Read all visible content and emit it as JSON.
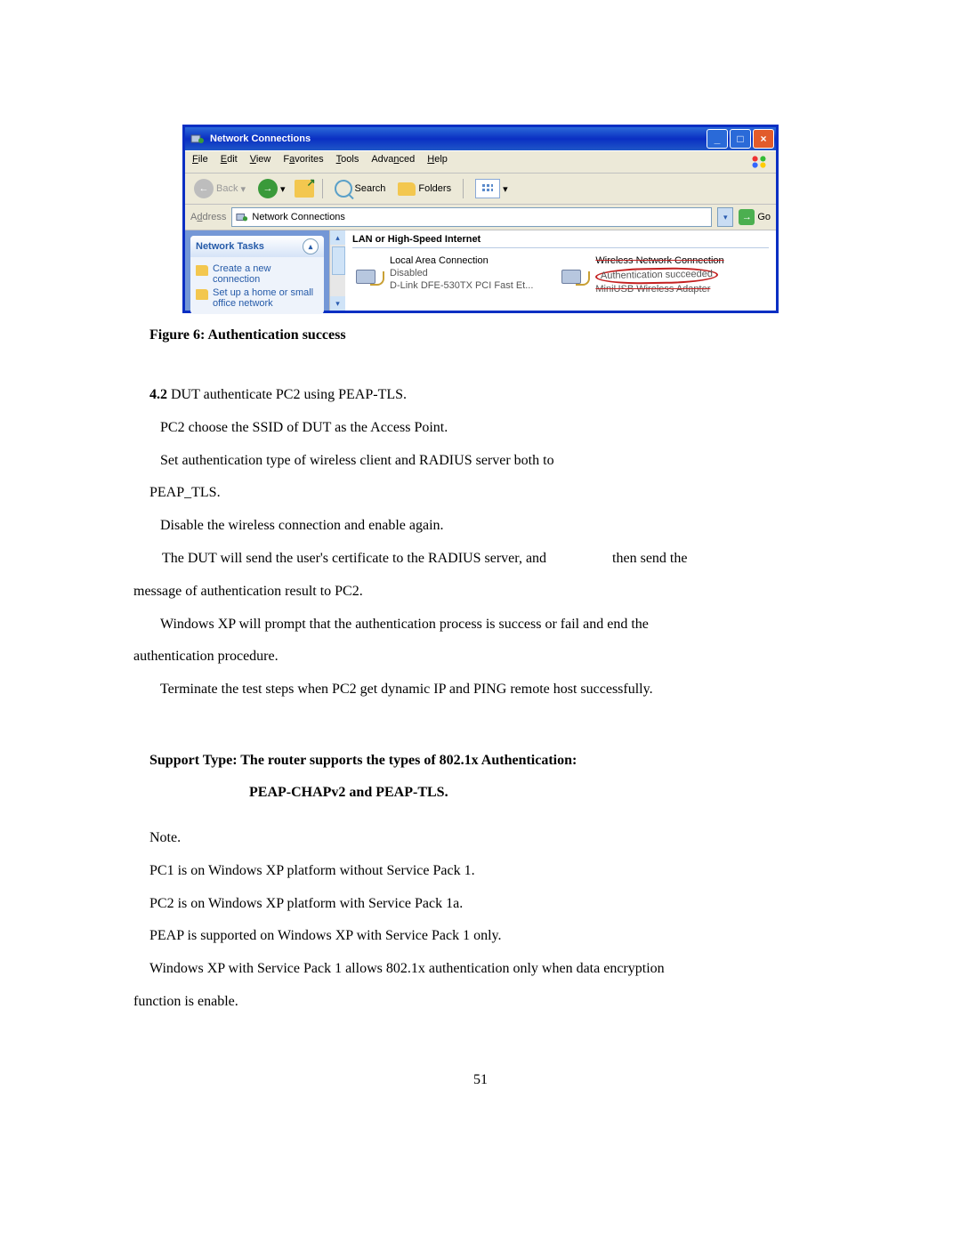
{
  "screenshot": {
    "title": "Network Connections",
    "menu": [
      "File",
      "Edit",
      "View",
      "Favorites",
      "Tools",
      "Advanced",
      "Help"
    ],
    "toolbar": {
      "backLabel": "Back",
      "searchLabel": "Search",
      "foldersLabel": "Folders"
    },
    "addressBar": {
      "label": "Address",
      "value": "Network Connections",
      "goLabel": "Go"
    },
    "sidePanel": {
      "header": "Network Tasks",
      "links": [
        "Create a new connection",
        "Set up a home or small office network"
      ]
    },
    "groupHeader": "LAN or High-Speed Internet",
    "connections": [
      {
        "line1": "Local Area Connection",
        "line2": "Disabled",
        "line3": "D-Link DFE-530TX PCI Fast Et..."
      },
      {
        "line1": "Wireless Network Connection",
        "line2": "Authentication succeeded",
        "line3": "MiniUSB Wireless Adapter"
      }
    ]
  },
  "figureCaption": "Figure 6: Authentication success",
  "body": {
    "sec": "4.2",
    "secLine": " DUT authenticate PC2 using PEAP-TLS.",
    "p1": "PC2 choose the SSID of DUT as the Access Point.",
    "p2": "Set authentication type of wireless client and RADIUS server both to",
    "p3": "PEAP_TLS.",
    "p4": "Disable the wireless connection and enable again.",
    "p5a": "The DUT will send the user's certificate to the RADIUS server, and",
    "p5b": "then send the",
    "p5wrap": "message of authentication result to PC2.",
    "p6a": "Windows XP will prompt that the authentication process is success or fail and end the",
    "p6wrap": "authentication procedure.",
    "p7": "Terminate the test steps when PC2 get dynamic IP and PING remote host successfully."
  },
  "support": {
    "line1": "Support Type: The router supports the types of 802.1x Authentication:",
    "line2": "PEAP-CHAPv2 and PEAP-TLS."
  },
  "notes": {
    "n0": "Note.",
    "n1": "PC1 is on Windows XP platform without Service Pack 1.",
    "n2": "PC2 is on Windows XP platform with Service Pack 1a.",
    "n3": "PEAP is supported on Windows XP with Service Pack 1 only.",
    "n4a": "Windows XP with Service Pack 1 allows 802.1x authentication only when data encryption",
    "n4wrap": "function is enable."
  },
  "pageNumber": "51"
}
